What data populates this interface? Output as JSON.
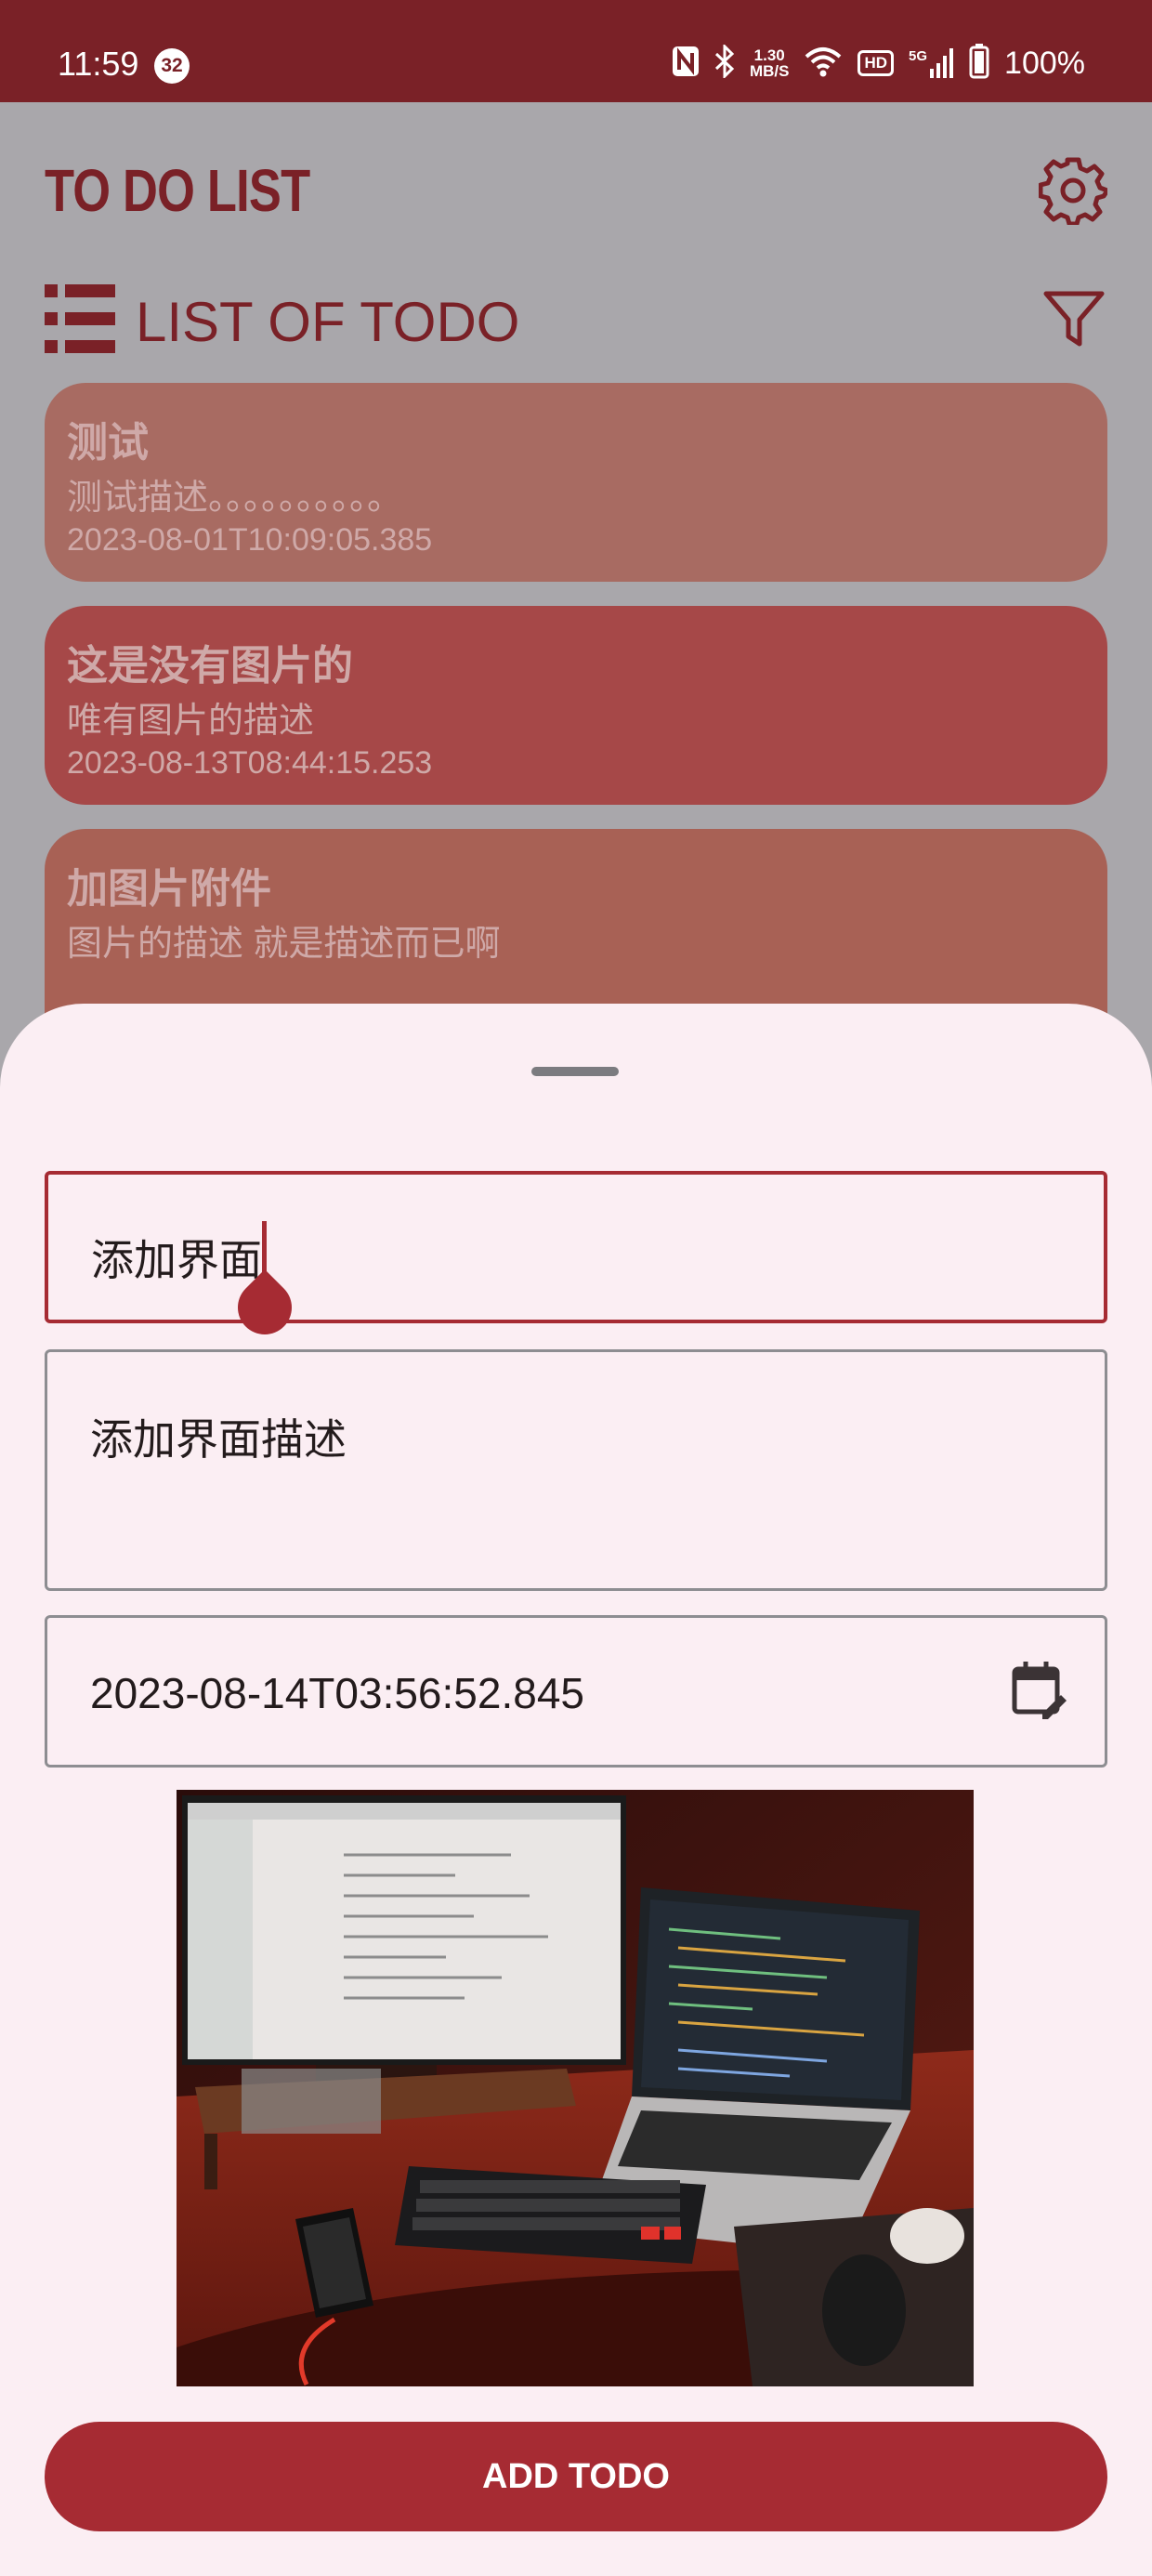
{
  "status_bar": {
    "time": "11:59",
    "notification_count": "32",
    "net_speed_value": "1.30",
    "net_speed_unit": "MB/S",
    "hd_label": "HD",
    "signal_label": "5G",
    "battery": "100%"
  },
  "app": {
    "title": "TO DO LIST",
    "section_title": "LIST OF TODO"
  },
  "todos": [
    {
      "title": "测试",
      "description": "测试描述。。。。。。。。。。",
      "date": "2023-08-01T10:09:05.385",
      "color": "#a86b62"
    },
    {
      "title": "这是没有图片的",
      "description": "唯有图片的描述",
      "date": "2023-08-13T08:44:15.253",
      "color": "#a64848"
    },
    {
      "title": "加图片附件",
      "description": "图片的描述 就是描述而已啊",
      "date": "",
      "color": "#a86155"
    }
  ],
  "form": {
    "title_value": "添加界面",
    "description_value": "添加界面描述",
    "date_value": "2023-08-14T03:56:52.845",
    "add_button_label": "ADD TODO"
  },
  "icons": [
    "settings-gear-icon",
    "list-icon",
    "filter-icon",
    "calendar-edit-icon",
    "nfc-icon",
    "bluetooth-icon",
    "wifi-icon",
    "signal-icon",
    "battery-icon"
  ],
  "colors": {
    "accent": "#a62b33",
    "status_bar": "#7a2127",
    "sheet_background": "#fbeef3",
    "scrim": "#a9a7ab"
  }
}
